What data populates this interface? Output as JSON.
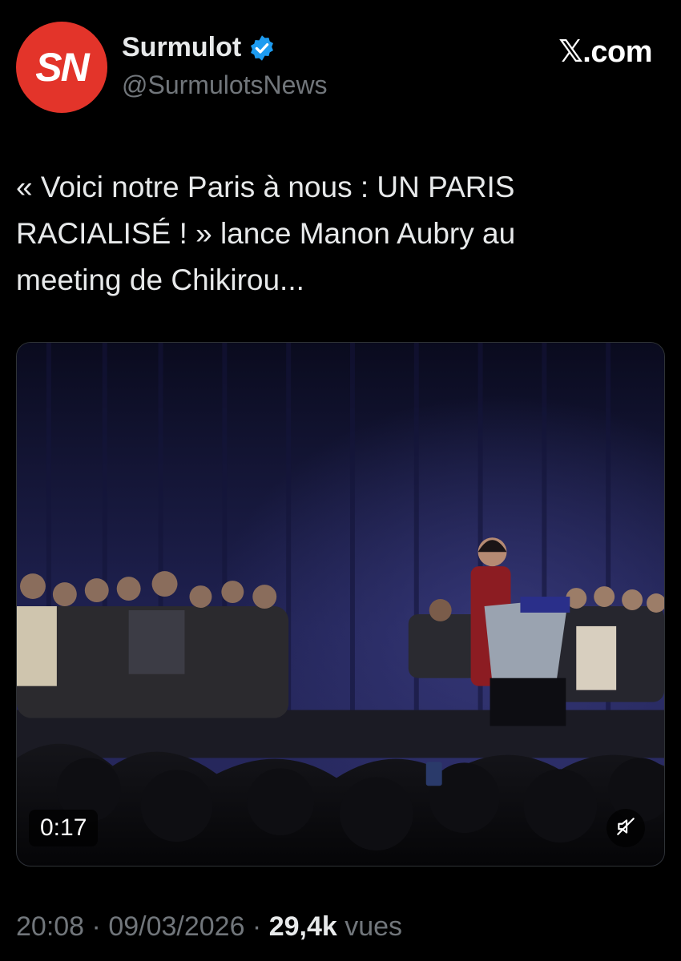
{
  "account": {
    "avatar_text": "SN",
    "avatar_color": "#e3342a",
    "display_name": "Surmulot",
    "verified_icon": "verified-badge-icon",
    "handle": "@SurmulotsNews"
  },
  "brand": {
    "label": "𝕏.com"
  },
  "tweet": {
    "text": "« Voici notre Paris à nous : UN PARIS\nRACIALISÉ ! » lance Manon Aubry au\nmeeting de Chikirou..."
  },
  "media": {
    "type": "video",
    "duration": "0:17",
    "mute_icon": "muted-speaker-icon"
  },
  "meta": {
    "time": "20:08",
    "sep1": " · ",
    "date": "09/03/2026",
    "sep2": " · ",
    "views_count": "29,4k",
    "views_label": " vues"
  },
  "colors": {
    "background": "#000000",
    "text": "#e7e9ea",
    "secondary": "#71767b",
    "verified": "#1d9bf0"
  }
}
